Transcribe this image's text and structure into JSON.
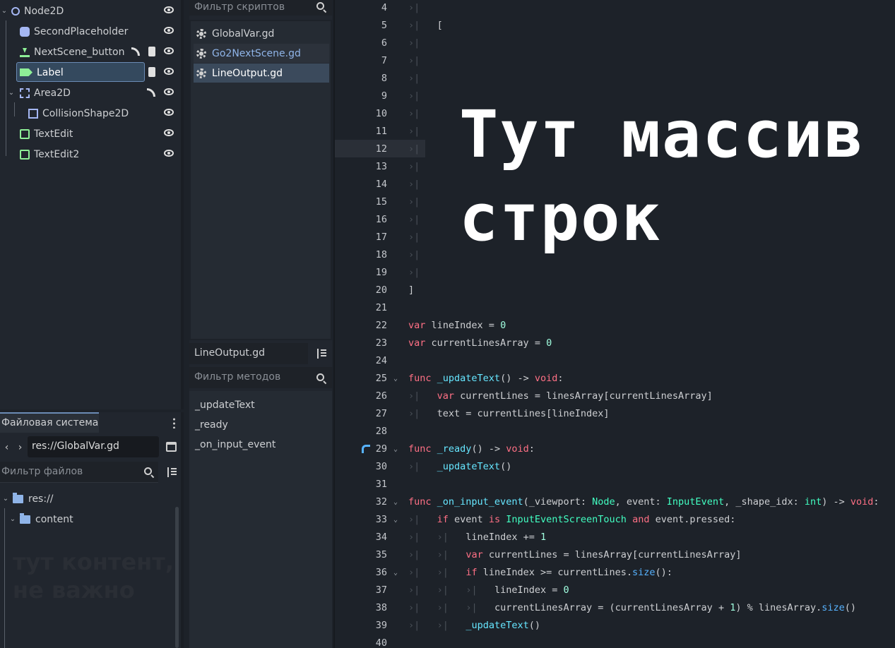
{
  "scene_tree": {
    "nodes": [
      {
        "name": "Node2D"
      },
      {
        "name": "SecondPlaceholder"
      },
      {
        "name": "NextScene_button"
      },
      {
        "name": "Label"
      },
      {
        "name": "Area2D"
      },
      {
        "name": "CollisionShape2D"
      },
      {
        "name": "TextEdit"
      },
      {
        "name": "TextEdit2"
      }
    ]
  },
  "filesystem": {
    "tab_label": "Файловая система",
    "path_value": "res://GlobalVar.gd",
    "filter_placeholder": "Фильтр файлов",
    "items": [
      {
        "name": "res://"
      },
      {
        "name": "content"
      }
    ],
    "ghost_text": "тут контент,\nне важно"
  },
  "scripts": {
    "filter_placeholder": "Фильтр скриптов",
    "items": [
      {
        "name": "GlobalVar.gd"
      },
      {
        "name": "Go2NextScene.gd"
      },
      {
        "name": "LineOutput.gd"
      }
    ]
  },
  "methods": {
    "current_script": "LineOutput.gd",
    "filter_placeholder": "Фильтр методов",
    "items": [
      "_updateText",
      "_ready",
      "_on_input_event"
    ]
  },
  "editor": {
    "overlay_text": "Тут массив\nстрок",
    "current_line": 12,
    "lines": [
      {
        "n": "4",
        "fold": "",
        "html": "<span class='tab'>›|</span>"
      },
      {
        "n": "5",
        "fold": "",
        "html": "<span class='tab'>›|</span>   ["
      },
      {
        "n": "6",
        "fold": "",
        "html": "<span class='tab'>›|</span>"
      },
      {
        "n": "7",
        "fold": "",
        "html": "<span class='tab'>›|</span>"
      },
      {
        "n": "8",
        "fold": "",
        "html": "<span class='tab'>›|</span>"
      },
      {
        "n": "9",
        "fold": "",
        "html": "<span class='tab'>›|</span>"
      },
      {
        "n": "10",
        "fold": "",
        "html": "<span class='tab'>›|</span>"
      },
      {
        "n": "11",
        "fold": "",
        "html": "<span class='tab'>›|</span>"
      },
      {
        "n": "12",
        "fold": "",
        "html": "<span class='tab'>›|</span>"
      },
      {
        "n": "13",
        "fold": "",
        "html": "<span class='tab'>›|</span>"
      },
      {
        "n": "14",
        "fold": "",
        "html": "<span class='tab'>›|</span>"
      },
      {
        "n": "15",
        "fold": "",
        "html": "<span class='tab'>›|</span>"
      },
      {
        "n": "16",
        "fold": "",
        "html": "<span class='tab'>›|</span>"
      },
      {
        "n": "17",
        "fold": "",
        "html": "<span class='tab'>›|</span>"
      },
      {
        "n": "18",
        "fold": "",
        "html": "<span class='tab'>›|</span>"
      },
      {
        "n": "19",
        "fold": "",
        "html": "<span class='tab'>›|</span>"
      },
      {
        "n": "20",
        "fold": "",
        "html": "]"
      },
      {
        "n": "21",
        "fold": "",
        "html": ""
      },
      {
        "n": "22",
        "fold": "",
        "html": "<span class='kw'>var</span> lineIndex = <span class='nu'>0</span>"
      },
      {
        "n": "23",
        "fold": "",
        "html": "<span class='kw'>var</span> currentLinesArray = <span class='nu'>0</span>"
      },
      {
        "n": "24",
        "fold": "",
        "html": ""
      },
      {
        "n": "25",
        "fold": "⌄",
        "html": "<span class='kw'>func</span> <span class='fn'>_updateText</span>() -&gt; <span class='kw'>void</span>:"
      },
      {
        "n": "26",
        "fold": "",
        "html": "<span class='tab'>›|</span>   <span class='kw'>var</span> currentLines = linesArray[currentLinesArray]"
      },
      {
        "n": "27",
        "fold": "",
        "html": "<span class='tab'>›|</span>   text = currentLines[lineIndex]"
      },
      {
        "n": "28",
        "fold": "",
        "html": ""
      },
      {
        "n": "29",
        "fold": "⌄",
        "html": "<span class='kw'>func</span> <span class='fn'>_ready</span>() -&gt; <span class='kw'>void</span>:"
      },
      {
        "n": "30",
        "fold": "",
        "html": "<span class='tab'>›|</span>   <span class='fn'>_updateText</span>()"
      },
      {
        "n": "31",
        "fold": "",
        "html": ""
      },
      {
        "n": "32",
        "fold": "⌄",
        "html": "<span class='kw'>func</span> <span class='fn'>_on_input_event</span>(_viewport: <span class='ty'>Node</span>, event: <span class='ty'>InputEvent</span>, _shape_idx: <span class='ty'>int</span>) -&gt; <span class='kw'>void</span>:"
      },
      {
        "n": "33",
        "fold": "⌄",
        "html": "<span class='tab'>›|</span>   <span class='kw'>if</span> event <span class='kw'>is</span> <span class='ty'>InputEventScreenTouch</span> <span class='kw'>and</span> event.pressed:"
      },
      {
        "n": "34",
        "fold": "",
        "html": "<span class='tab'>›|</span>   <span class='tab'>›|</span>   lineIndex += <span class='nu'>1</span>"
      },
      {
        "n": "35",
        "fold": "",
        "html": "<span class='tab'>›|</span>   <span class='tab'>›|</span>   <span class='kw'>var</span> currentLines = linesArray[currentLinesArray]"
      },
      {
        "n": "36",
        "fold": "⌄",
        "html": "<span class='tab'>›|</span>   <span class='tab'>›|</span>   <span class='kw'>if</span> lineIndex &gt;= currentLines.<span class='me'>size</span>():"
      },
      {
        "n": "37",
        "fold": "",
        "html": "<span class='tab'>›|</span>   <span class='tab'>›|</span>   <span class='tab'>›|</span>   lineIndex = <span class='nu'>0</span>"
      },
      {
        "n": "38",
        "fold": "",
        "html": "<span class='tab'>›|</span>   <span class='tab'>›|</span>   <span class='tab'>›|</span>   currentLinesArray = (currentLinesArray + <span class='nu'>1</span>) % linesArray.<span class='me'>size</span>()"
      },
      {
        "n": "39",
        "fold": "",
        "html": "<span class='tab'>›|</span>   <span class='tab'>›|</span>   <span class='fn'>_updateText</span>()"
      },
      {
        "n": "40",
        "fold": "",
        "html": ""
      }
    ]
  }
}
